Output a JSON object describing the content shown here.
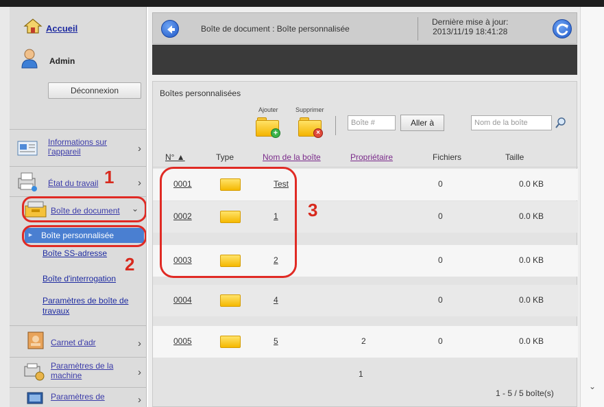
{
  "sidebar": {
    "home_label": "Accueil",
    "user_label": "Admin",
    "logout_label": "Déconnexion",
    "items": [
      {
        "label": "Informations sur l'appareil"
      },
      {
        "label": "État du travail"
      },
      {
        "label": "Boîte de document"
      },
      {
        "label": "Carnet d'adr"
      },
      {
        "label": "Paramètres de la machine"
      },
      {
        "label": "Paramètres de"
      }
    ],
    "subitems": [
      {
        "label": "Boîte personnalisée"
      },
      {
        "label": "Boîte SS-adresse"
      },
      {
        "label": "Boîte d'interrogation"
      },
      {
        "label": "Paramètres de boîte de travaux"
      }
    ]
  },
  "annotations": [
    "1",
    "2",
    "3"
  ],
  "header": {
    "title": "Boîte de document : Boîte personnalisée",
    "update_label": "Dernière mise à jour:",
    "update_time": "2013/11/19 18:41:28"
  },
  "panel": {
    "title": "Boîtes personnalisées",
    "add_label": "Ajouter",
    "delete_label": "Supprimer",
    "box_no_placeholder": "Boîte #",
    "go_label": "Aller à",
    "box_name_placeholder": "Nom de la boîte",
    "columns": {
      "number": "N° ▲",
      "type": "Type",
      "name": "Nom de la boîte",
      "owner": "Propriétaire",
      "files": "Fichiers",
      "size": "Taille"
    },
    "rows": [
      {
        "number": "0001",
        "name": "Test",
        "owner": "",
        "files": "0",
        "size": "0.0 KB"
      },
      {
        "number": "0002",
        "name": "1",
        "owner": "",
        "files": "0",
        "size": "0.0 KB"
      },
      {
        "number": "0003",
        "name": "2",
        "owner": "",
        "files": "0",
        "size": "0.0 KB"
      },
      {
        "number": "0004",
        "name": "4",
        "owner": "",
        "files": "0",
        "size": "0.0 KB"
      },
      {
        "number": "0005",
        "name": "5",
        "owner": "2",
        "files": "0",
        "size": "0.0 KB"
      }
    ],
    "page": "1",
    "count": "1 - 5 / 5 boîte(s)"
  },
  "colors": {
    "accent": "#1f58c8",
    "selected": "#4a7fd1",
    "annotation": "#d72a1e"
  }
}
